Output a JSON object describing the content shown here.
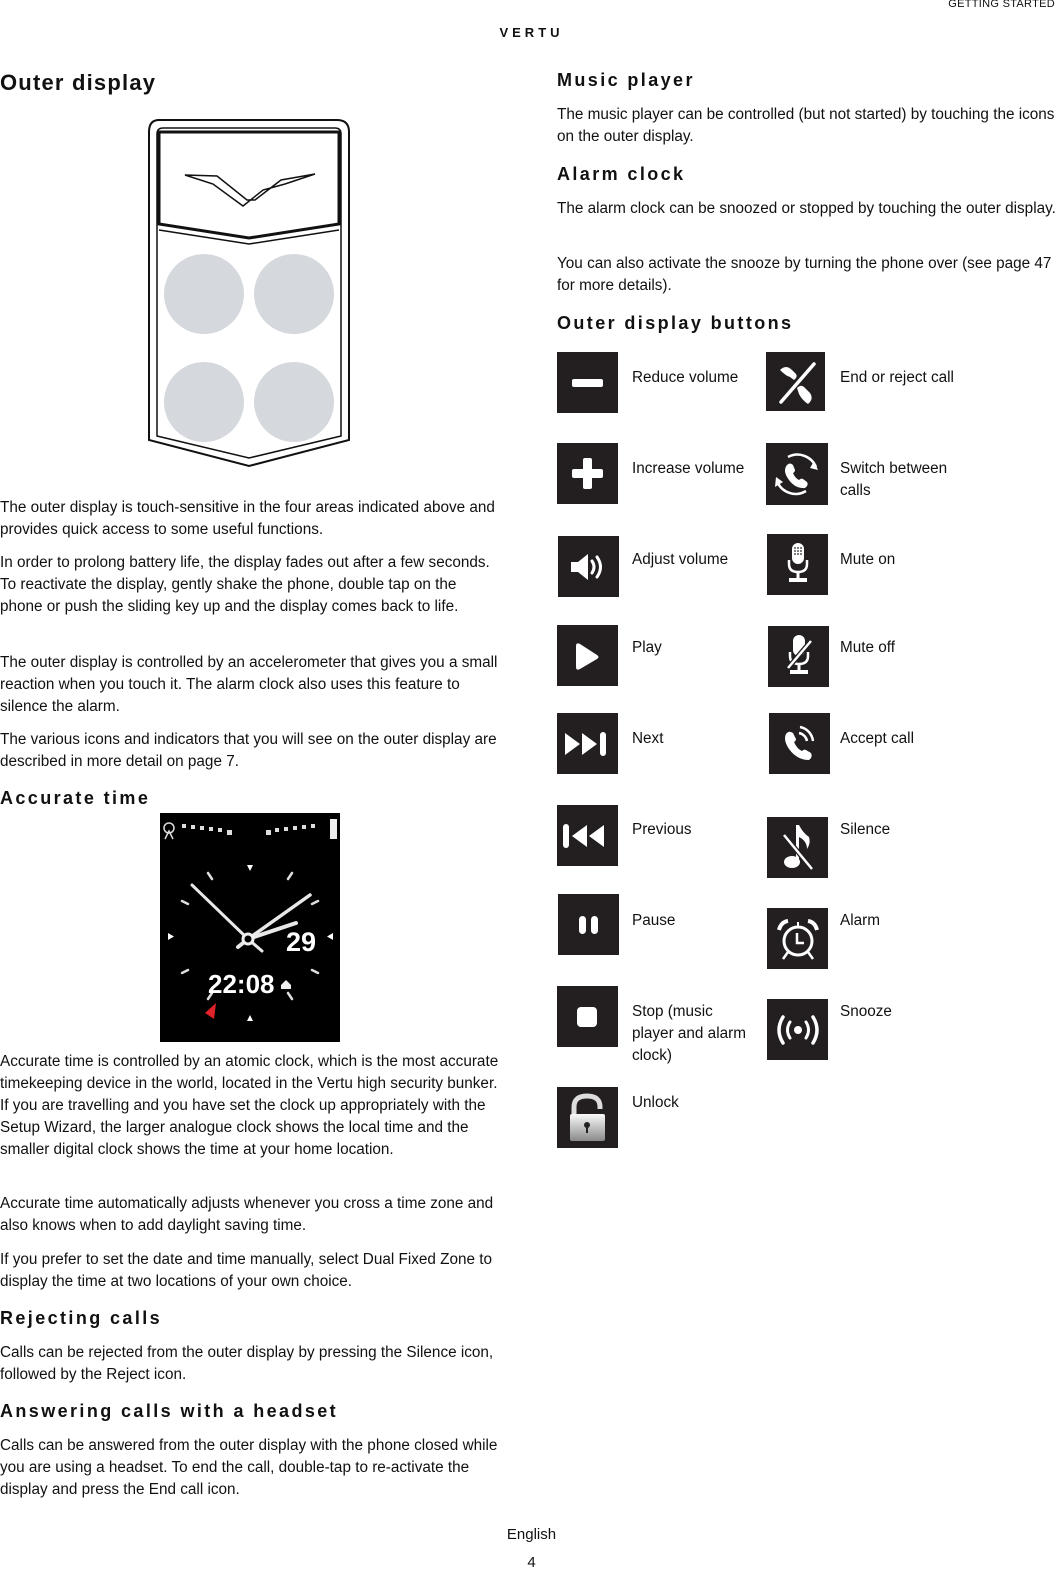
{
  "header": {
    "running_head": "GETTING STARTED",
    "brand": "VERTU"
  },
  "left": {
    "title": "Outer display",
    "phone_figure_alt": "Outer display with four touch-sensitive areas",
    "paragraphs": [
      "The outer display is touch-sensitive in the four areas indicated above and provides quick access to some useful functions.",
      "In order to prolong battery life, the display fades out after a few seconds. To reactivate the display, gently shake the phone, double tap on the phone or push the sliding key up and the display comes back to life.",
      "The outer display is controlled by an accelerometer that gives you a small reaction when you touch it. The alarm clock also uses this feature to silence the alarm.",
      "The various icons and indicators that you will see on the outer display are described in more detail on page 7."
    ],
    "accurate_time": {
      "heading": "Accurate time",
      "clock": {
        "digital_time": "22:08",
        "date": "29"
      },
      "paragraphs": [
        "Accurate time is controlled by an atomic clock, which is the most accurate timekeeping device in the world, located in the Vertu high security bunker. If you are travelling and you have set the clock up appropriately with the Setup Wizard, the larger analogue clock shows the local time and the smaller digital clock shows the time at your home location.",
        "Accurate time automatically adjusts whenever you cross a time zone and also knows when to add daylight saving time.",
        "If you prefer to set the date and time manually, select Dual Fixed Zone to display the time at two locations of your own choice."
      ]
    },
    "rejecting_calls": {
      "heading": "Rejecting calls",
      "paragraph": "Calls can be rejected from the outer display by pressing the Silence icon, followed by the Reject icon."
    },
    "answering_calls": {
      "heading": "Answering calls with a headset",
      "paragraph": "Calls can be answered from the outer display with the phone closed while you are using a headset. To end the call, double-tap to re-activate the display and press the End call icon."
    }
  },
  "right": {
    "music_player": {
      "heading": "Music player",
      "paragraph": "The music player can be controlled (but not started) by touching the icons on the outer display."
    },
    "alarm_clock": {
      "heading": "Alarm clock",
      "paragraphs": [
        "The alarm clock can be snoozed or stopped by touching the outer display.",
        "You can also activate the snooze by turning the phone over (see page 47 for more details)."
      ]
    },
    "outer_buttons": {
      "heading": "Outer display buttons",
      "left_column": [
        {
          "icon": "minus-icon",
          "label": "Reduce volume"
        },
        {
          "icon": "plus-icon",
          "label": "Increase volume"
        },
        {
          "icon": "speaker-icon",
          "label": "Adjust volume"
        },
        {
          "icon": "play-icon",
          "label": "Play"
        },
        {
          "icon": "next-icon",
          "label": "Next"
        },
        {
          "icon": "previous-icon",
          "label": "Previous"
        },
        {
          "icon": "pause-icon",
          "label": "Pause"
        },
        {
          "icon": "stop-icon",
          "label": "Stop (music player and alarm clock)"
        },
        {
          "icon": "unlock-icon",
          "label": "Unlock"
        }
      ],
      "right_column": [
        {
          "icon": "end-call-icon",
          "label": "End or reject call"
        },
        {
          "icon": "switch-calls-icon",
          "label": "Switch between calls"
        },
        {
          "icon": "microphone-icon",
          "label": "Mute on"
        },
        {
          "icon": "microphone-off-icon",
          "label": "Mute off"
        },
        {
          "icon": "accept-call-icon",
          "label": "Accept call"
        },
        {
          "icon": "silence-icon",
          "label": "Silence"
        },
        {
          "icon": "alarm-icon",
          "label": "Alarm"
        },
        {
          "icon": "snooze-icon",
          "label": "Snooze"
        }
      ]
    }
  },
  "footer": {
    "language": "English",
    "page_number": "4"
  },
  "colors": {
    "icon_background": "#231f20",
    "touch_area": "#d5d8dd",
    "text": "#111111"
  }
}
